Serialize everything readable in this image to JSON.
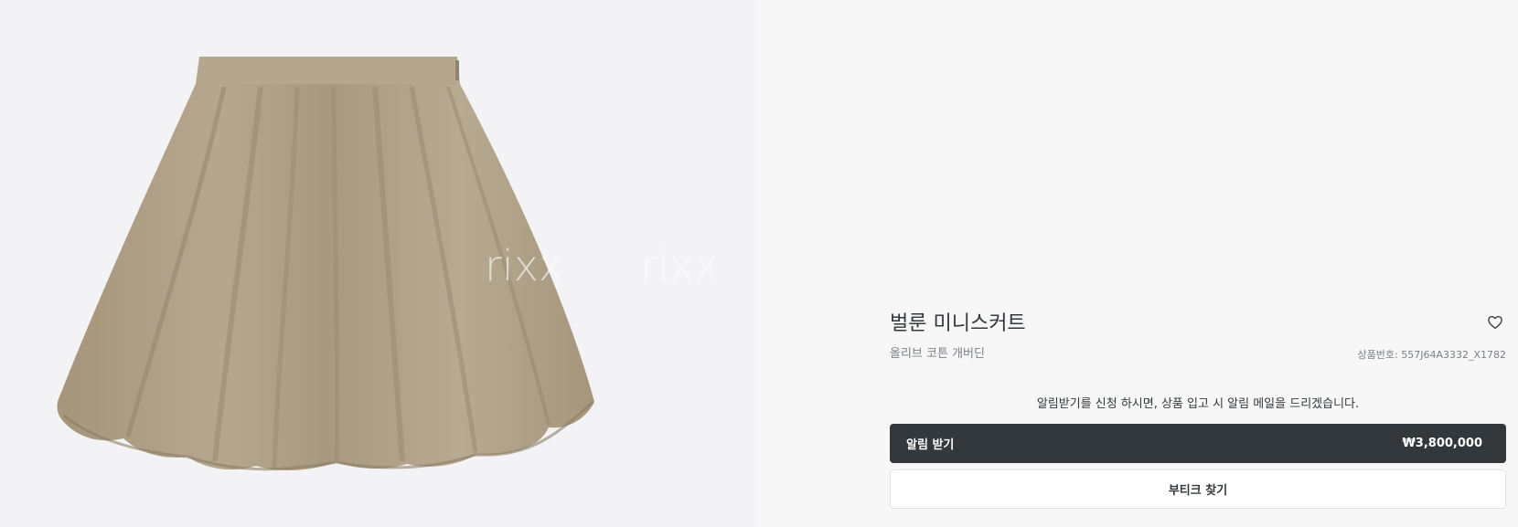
{
  "product": {
    "title": "벌룬 미니스커트",
    "material": "올리브 코튼 개버딘",
    "sku_label": "상품번호: ",
    "sku_value": "557J64A3332_X1782",
    "image_alt": "beige balloon mini skirt"
  },
  "watermarks": [
    "rixx",
    "rixx",
    "rixx",
    "rixx"
  ],
  "notify": {
    "notice": "알림받기를 신청 하시면, 상품 입고 시 알림 메일을 드리겠습니다.",
    "button_label": "알림 받기",
    "price": "₩3,800,000"
  },
  "boutique": {
    "button_label": "부티크 찾기"
  },
  "colors": {
    "image_bg": "#f3f2f4",
    "page_bg": "#f7f7f8",
    "skirt": "#b2a38a",
    "primary_button": "#33383c"
  },
  "icons": {
    "wishlist": "heart-outline-icon"
  }
}
